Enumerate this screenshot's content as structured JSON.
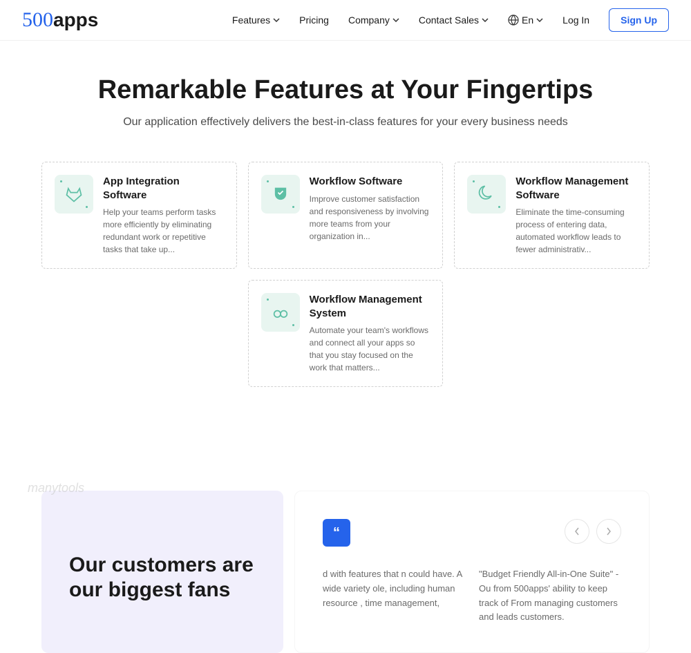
{
  "header": {
    "logo_500": "500",
    "logo_apps": "apps",
    "nav": {
      "features": "Features",
      "pricing": "Pricing",
      "company": "Company",
      "contact": "Contact Sales",
      "lang": "En",
      "login": "Log In",
      "signup": "Sign Up"
    }
  },
  "main": {
    "title": "Remarkable Features at Your Fingertips",
    "subtitle": "Our application effectively delivers the best-in-class features for your every business needs"
  },
  "cards": {
    "0": {
      "title": "App Integration Software",
      "desc": "Help your teams perform tasks more efficiently by eliminating redundant work or repetitive tasks that take up..."
    },
    "1": {
      "title": "Workflow Software",
      "desc": "Improve customer satisfaction and responsiveness by involving more teams from your organization in..."
    },
    "2": {
      "title": "Workflow Management Software",
      "desc": "Eliminate the time-consuming process of entering data, automated workflow leads to fewer administrativ..."
    },
    "3": {
      "title": "Workflow Management System",
      "desc": "Automate your team's workflows and connect all your apps so that you stay focused on the work that matters..."
    }
  },
  "testimonials": {
    "heading": "Our customers are our biggest fans",
    "col1": "d with features that n could have. A wide variety ole, including human resource , time management,",
    "col2": "\"Budget Friendly All-in-One Suite\" - Ou from 500apps' ability to keep track of From managing customers and leads customers."
  },
  "watermark": "manytools"
}
